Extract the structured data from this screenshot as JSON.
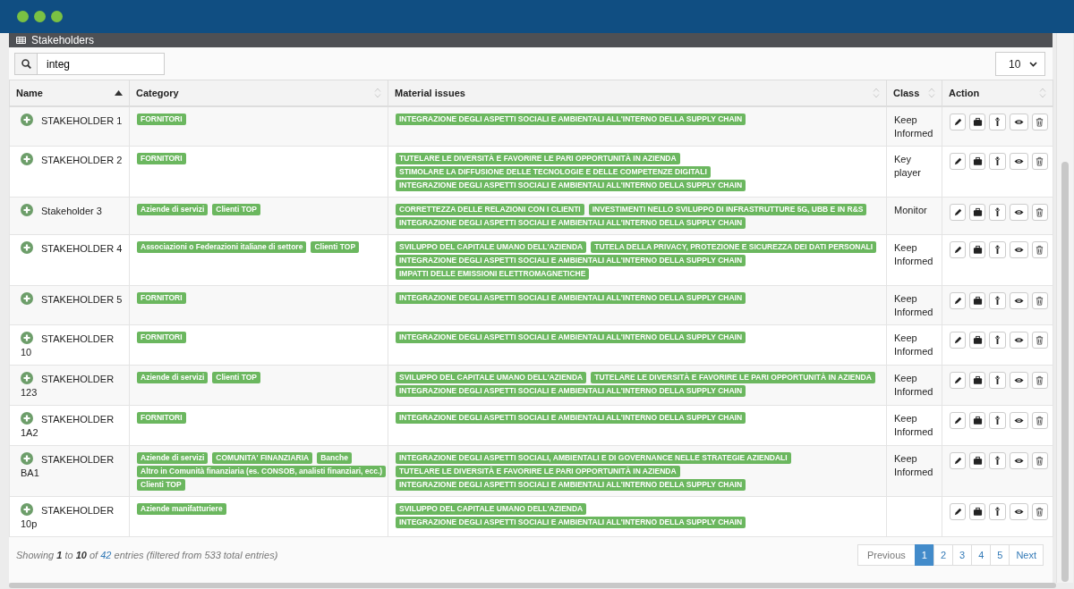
{
  "panel": {
    "title": "Stakeholders"
  },
  "search": {
    "value": "integ"
  },
  "page_length": {
    "value": "10"
  },
  "table": {
    "columns": [
      {
        "label": "Name",
        "sorted": true
      },
      {
        "label": "Category",
        "sorted": false
      },
      {
        "label": "Material issues",
        "sorted": false
      },
      {
        "label": "Class",
        "sorted": false
      },
      {
        "label": "Action",
        "sorted": false
      }
    ],
    "rows": [
      {
        "name": "STAKEHOLDER 1",
        "categories": [
          "FORNITORI"
        ],
        "issues": [
          "INTEGRAZIONE DEGLI ASPETTI SOCIALI E AMBIENTALI ALL'INTERNO DELLA SUPPLY CHAIN"
        ],
        "class": "Keep Informed"
      },
      {
        "name": "STAKEHOLDER 2",
        "categories": [
          "FORNITORI"
        ],
        "issues": [
          "TUTELARE LE DIVERSITÀ E FAVORIRE LE PARI OPPORTUNITÀ IN AZIENDA",
          "STIMOLARE LA DIFFUSIONE DELLE TECNOLOGIE E DELLE COMPETENZE DIGITALI",
          "INTEGRAZIONE DEGLI ASPETTI SOCIALI E AMBIENTALI ALL'INTERNO DELLA SUPPLY CHAIN"
        ],
        "class": "Key player"
      },
      {
        "name": "Stakeholder 3",
        "categories": [
          "Aziende di servizi",
          "Clienti TOP"
        ],
        "issues": [
          "CORRETTEZZA DELLE RELAZIONI CON I CLIENTI",
          "INVESTIMENTI NELLO SVILUPPO DI INFRASTRUTTURE 5G, UBB E IN R&S",
          "INTEGRAZIONE DEGLI ASPETTI SOCIALI E AMBIENTALI ALL'INTERNO DELLA SUPPLY CHAIN"
        ],
        "class": "Monitor"
      },
      {
        "name": "STAKEHOLDER 4",
        "categories": [
          "Associazioni o Federazioni italiane di settore",
          "Clienti TOP"
        ],
        "issues": [
          "SVILUPPO DEL CAPITALE UMANO DELL'AZIENDA",
          "TUTELA DELLA PRIVACY, PROTEZIONE E SICUREZZA DEI DATI PERSONALI",
          "INTEGRAZIONE DEGLI ASPETTI SOCIALI E AMBIENTALI ALL'INTERNO DELLA SUPPLY CHAIN",
          "IMPATTI DELLE EMISSIONI ELETTROMAGNETICHE"
        ],
        "class": "Keep Informed"
      },
      {
        "name": "STAKEHOLDER 5",
        "categories": [
          "FORNITORI"
        ],
        "issues": [
          "INTEGRAZIONE DEGLI ASPETTI SOCIALI E AMBIENTALI ALL'INTERNO DELLA SUPPLY CHAIN"
        ],
        "class": "Keep Informed"
      },
      {
        "name": "STAKEHOLDER 10",
        "categories": [
          "FORNITORI"
        ],
        "issues": [
          "INTEGRAZIONE DEGLI ASPETTI SOCIALI E AMBIENTALI ALL'INTERNO DELLA SUPPLY CHAIN"
        ],
        "class": "Keep Informed"
      },
      {
        "name": "STAKEHOLDER 123",
        "categories": [
          "Aziende di servizi",
          "Clienti TOP"
        ],
        "issues": [
          "SVILUPPO DEL CAPITALE UMANO DELL'AZIENDA",
          "TUTELARE LE DIVERSITÀ E FAVORIRE LE PARI OPPORTUNITÀ IN AZIENDA",
          "INTEGRAZIONE DEGLI ASPETTI SOCIALI E AMBIENTALI ALL'INTERNO DELLA SUPPLY CHAIN"
        ],
        "class": "Keep Informed"
      },
      {
        "name": "STAKEHOLDER 1A2",
        "categories": [
          "FORNITORI"
        ],
        "issues": [
          "INTEGRAZIONE DEGLI ASPETTI SOCIALI E AMBIENTALI ALL'INTERNO DELLA SUPPLY CHAIN"
        ],
        "class": "Keep Informed"
      },
      {
        "name": "STAKEHOLDER BA1",
        "categories": [
          "Aziende di servizi",
          "COMUNITA' FINANZIARIA",
          "Banche",
          "Altro in Comunità finanziaria (es. CONSOB, analisti finanziari, ecc.)",
          "Clienti TOP"
        ],
        "issues": [
          "INTEGRAZIONE DEGLI ASPETTI SOCIALI, AMBIENTALI E DI GOVERNANCE NELLE STRATEGIE AZIENDALI",
          "TUTELARE LE DIVERSITÀ E FAVORIRE LE PARI OPPORTUNITÀ IN AZIENDA",
          "INTEGRAZIONE DEGLI ASPETTI SOCIALI E AMBIENTALI ALL'INTERNO DELLA SUPPLY CHAIN"
        ],
        "class": "Keep Informed"
      },
      {
        "name": "STAKEHOLDER 10p",
        "categories": [
          "Aziende manifatturiere"
        ],
        "issues": [
          "SVILUPPO DEL CAPITALE UMANO DELL'AZIENDA",
          "INTEGRAZIONE DEGLI ASPETTI SOCIALI E AMBIENTALI ALL'INTERNO DELLA SUPPLY CHAIN"
        ]
      }
    ]
  },
  "info": "Showing **1** to **10** of **42** entries (filtered from 533 total entries)",
  "pagination": [
    {
      "label": "Previous",
      "selected": false
    },
    {
      "label": "1",
      "selected": true
    },
    {
      "label": "2",
      "selected": false
    },
    {
      "label": "3",
      "selected": false
    },
    {
      "label": "4",
      "selected": false
    },
    {
      "label": "5",
      "selected": false
    },
    {
      "label": "Next",
      "selected": false
    }
  ]
}
